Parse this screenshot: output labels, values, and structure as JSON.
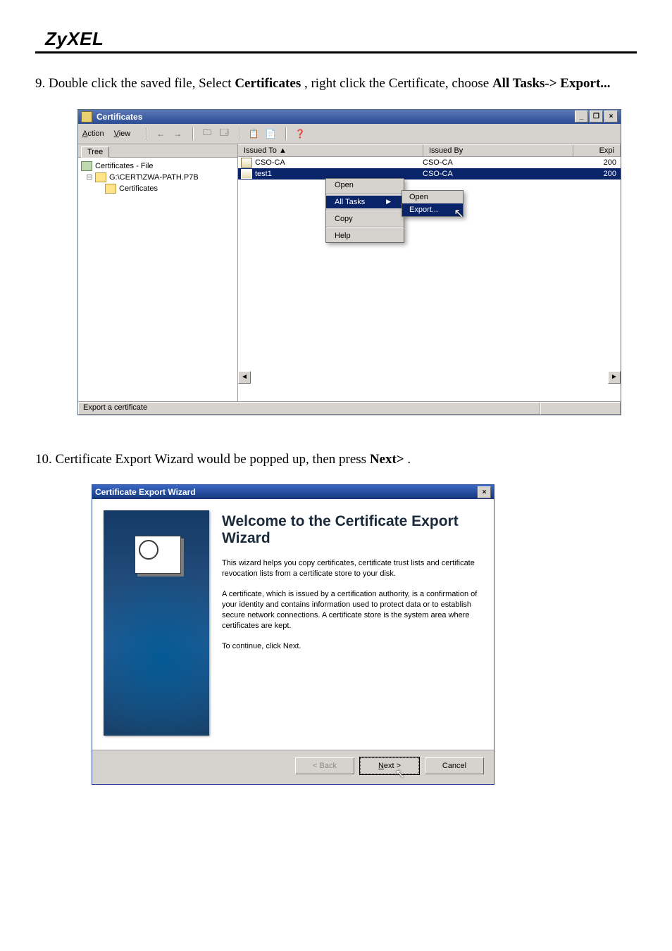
{
  "brand": "ZyXEL",
  "step9": {
    "prefix": "9. Double click the saved file, Select ",
    "bold1": "Certificates",
    "mid": ", right click the Certificate, choose ",
    "bold2": "All Tasks-> Export..."
  },
  "mmc": {
    "title": "Certificates",
    "sys": {
      "min": "_",
      "max": "❐",
      "close": "×"
    },
    "menus": {
      "action": "Action",
      "view": "View"
    },
    "toolbar": {
      "back": "←",
      "fwd": "→",
      "up": "⇧",
      "props": "☰",
      "copy": "⧉",
      "paste": "⧉",
      "help": "?"
    },
    "tree_tab": "Tree",
    "tree": {
      "root": "Certificates - File",
      "node": "G:\\CERT\\ZWA-PATH.P7B",
      "leaf": "Certificates"
    },
    "columns": {
      "c1": "Issued To  ▲",
      "c2": "Issued By",
      "c3": "Expi"
    },
    "rows": [
      {
        "name": "CSO-CA",
        "by": "CSO-CA",
        "exp": "200"
      },
      {
        "name": "test1",
        "by": "CSO-CA",
        "exp": "200"
      }
    ],
    "ctx": {
      "open": "Open",
      "alltasks": "All Tasks",
      "copy": "Copy",
      "help": "Help",
      "sub_open": "Open",
      "sub_export": "Export..."
    },
    "status": "Export a certificate"
  },
  "step10": {
    "prefix": "10. Certificate Export Wizard would be popped up, then press ",
    "bold": "Next>",
    "suffix": "."
  },
  "wizard": {
    "title": "Certificate Export Wizard",
    "close": "×",
    "heading": "Welcome to the Certificate Export Wizard",
    "p1": "This wizard helps you copy certificates, certificate trust lists and certificate revocation lists from a certificate store to your disk.",
    "p2": "A certificate, which is issued by a certification authority, is a confirmation of your identity and contains information used to protect data or to establish secure network connections. A certificate store is the system area where certificates are kept.",
    "p3": "To continue, click Next.",
    "buttons": {
      "back": "< Back",
      "next": "Next >",
      "cancel": "Cancel"
    }
  }
}
